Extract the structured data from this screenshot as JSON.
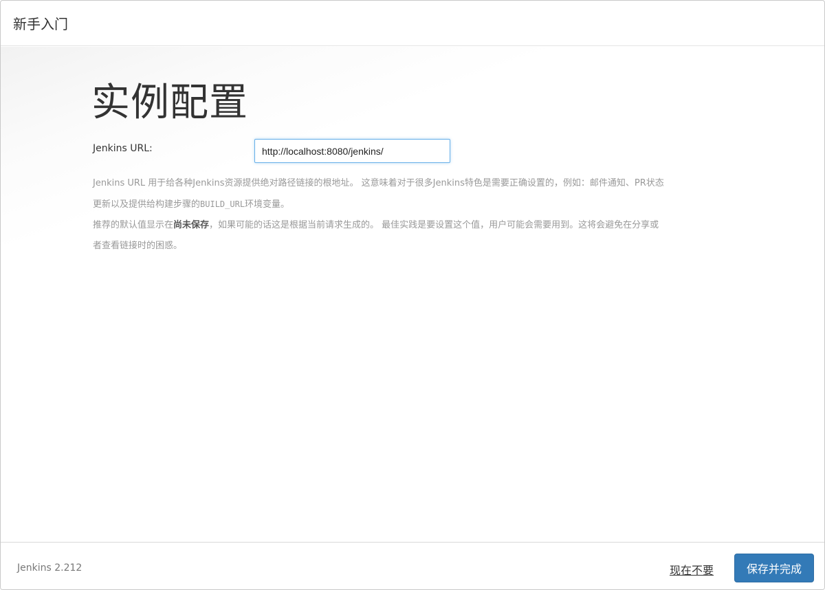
{
  "header": {
    "title": "新手入门"
  },
  "main": {
    "title": "实例配置",
    "url_field": {
      "label": "Jenkins URL:",
      "value": "http://localhost:8080/jenkins/"
    },
    "help": {
      "line1": "Jenkins URL 用于给各种Jenkins资源提供绝对路径链接的根地址。 这意味着对于很多Jenkins特色是需要正确设置的，例如：邮件通知、PR状态",
      "line2_pre": "更新以及提供给构建步骤的",
      "line2_code": "BUILD_URL",
      "line2_post": "环境变量。",
      "line3_pre": "推荐的默认值显示在",
      "line3_strong": "尚未保存",
      "line3_post": "，如果可能的话这是根据当前请求生成的。 最佳实践是要设置这个值，用户可能会需要用到。这将会避免在分享或",
      "line4": "者查看链接时的困惑。"
    }
  },
  "footer": {
    "version": "Jenkins 2.212",
    "skip_label": "现在不要",
    "save_label": "保存并完成"
  },
  "colors": {
    "primary_button": "#337ab7",
    "input_focus_border": "#66afe9",
    "help_text": "#999999"
  }
}
